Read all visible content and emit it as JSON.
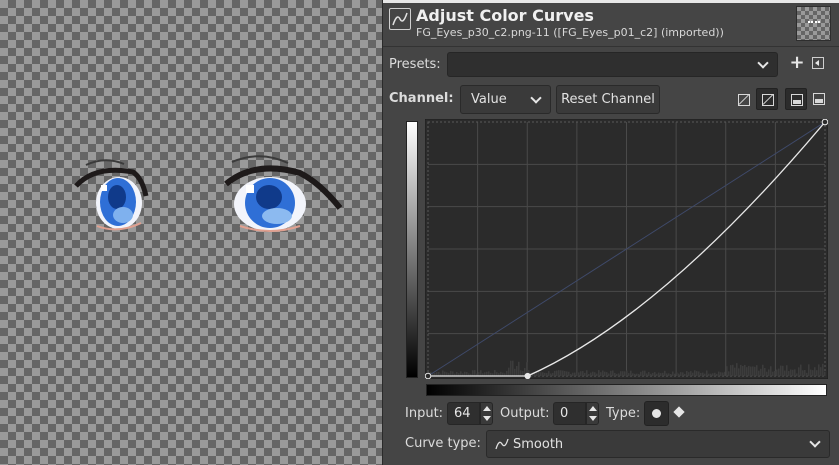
{
  "dialog": {
    "title": "Adjust Color Curves",
    "subtitle": "FG_Eyes_p30_c2.png-11 ([FG_Eyes_p01_c2] (imported))",
    "icon": "curves-icon",
    "thumbnail_icon": "layer-thumbnail"
  },
  "presets": {
    "label": "Presets:",
    "value": "",
    "add_icon": "plus-icon",
    "menu_icon": "preset-menu-icon"
  },
  "channel": {
    "label": "Channel:",
    "value": "Value",
    "reset_label": "Reset Channel",
    "icons": [
      "linear-curve-icon",
      "log-curve-icon",
      "histogram-linear-icon",
      "histogram-log-icon"
    ]
  },
  "curve": {
    "points": [
      {
        "input": 0,
        "output": 0
      },
      {
        "input": 64,
        "output": 0
      },
      {
        "input": 255,
        "output": 255
      }
    ],
    "type": "smooth"
  },
  "controls": {
    "input_label": "Input:",
    "input_value": "64",
    "output_label": "Output:",
    "output_value": "0",
    "type_label": "Type:",
    "type_icons": [
      "smooth-point-icon",
      "corner-point-icon"
    ]
  },
  "curve_type": {
    "label": "Curve type:",
    "value": "Smooth"
  },
  "colors": {
    "panel_bg": "#454545",
    "field_bg": "#2f2f2f",
    "curve_bg": "#2b2b2b",
    "curve_line": "#e8e8e8",
    "eye_iris": "#2f6fd6"
  }
}
